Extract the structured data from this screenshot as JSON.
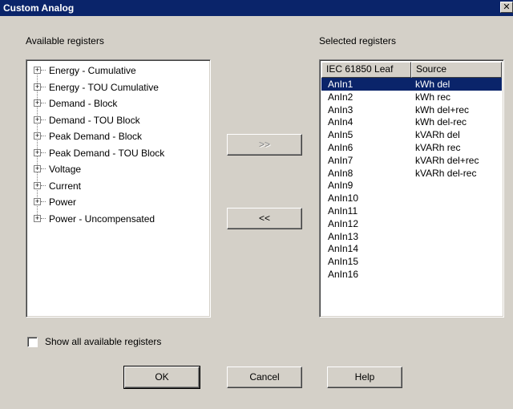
{
  "window": {
    "title": "Custom Analog",
    "close_glyph": "✕"
  },
  "available": {
    "label": "Available registers",
    "items": [
      {
        "label": "Energy - Cumulative"
      },
      {
        "label": "Energy - TOU Cumulative"
      },
      {
        "label": "Demand - Block"
      },
      {
        "label": "Demand - TOU Block"
      },
      {
        "label": "Peak Demand - Block"
      },
      {
        "label": "Peak Demand - TOU Block"
      },
      {
        "label": "Voltage"
      },
      {
        "label": "Current"
      },
      {
        "label": "Power"
      },
      {
        "label": "Power - Uncompensated"
      }
    ],
    "expander_glyph": "+"
  },
  "selected": {
    "label": "Selected registers",
    "columns": [
      "IEC 61850 Leaf",
      "Source"
    ],
    "rows": [
      {
        "leaf": "AnIn1",
        "source": "kWh del",
        "selected": true
      },
      {
        "leaf": "AnIn2",
        "source": "kWh rec"
      },
      {
        "leaf": "AnIn3",
        "source": "kWh del+rec"
      },
      {
        "leaf": "AnIn4",
        "source": "kWh del-rec"
      },
      {
        "leaf": "AnIn5",
        "source": "kVARh del"
      },
      {
        "leaf": "AnIn6",
        "source": "kVARh rec"
      },
      {
        "leaf": "AnIn7",
        "source": "kVARh del+rec"
      },
      {
        "leaf": "AnIn8",
        "source": "kVARh del-rec"
      },
      {
        "leaf": "AnIn9",
        "source": ""
      },
      {
        "leaf": "AnIn10",
        "source": ""
      },
      {
        "leaf": "AnIn11",
        "source": ""
      },
      {
        "leaf": "AnIn12",
        "source": ""
      },
      {
        "leaf": "AnIn13",
        "source": ""
      },
      {
        "leaf": "AnIn14",
        "source": ""
      },
      {
        "leaf": "AnIn15",
        "source": ""
      },
      {
        "leaf": "AnIn16",
        "source": ""
      }
    ]
  },
  "buttons": {
    "add": ">>",
    "remove": "<<",
    "ok": "OK",
    "cancel": "Cancel",
    "help": "Help"
  },
  "options": {
    "show_all_label": "Show all available registers",
    "show_all_checked": false
  },
  "colors": {
    "titlebar": "#0a246a",
    "face": "#d4d0c8",
    "selection": "#0a246a"
  }
}
